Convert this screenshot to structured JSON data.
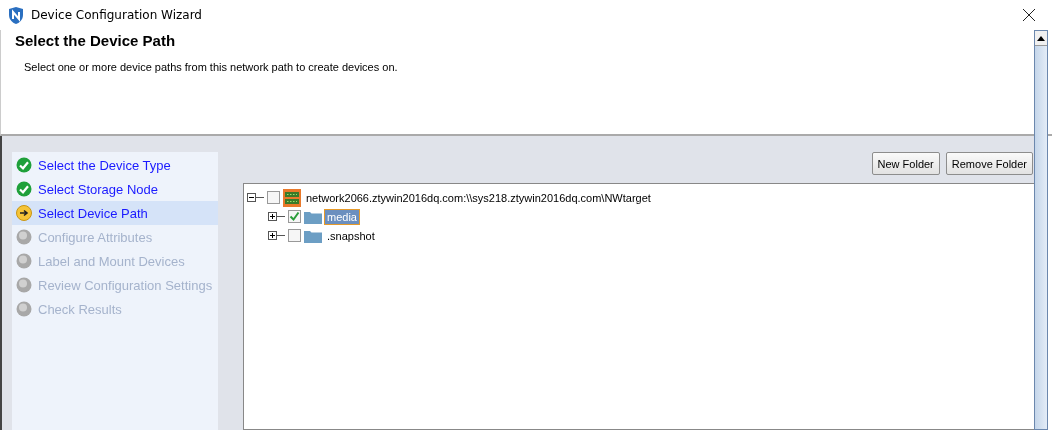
{
  "window": {
    "title": "Device Configuration Wizard"
  },
  "header": {
    "title": "Select the Device Path",
    "description": "Select one or more device paths from this network path to create devices on."
  },
  "steps": [
    {
      "label": "Select the Device Type",
      "kind": "done",
      "selected": false
    },
    {
      "label": "Select Storage Node",
      "kind": "done",
      "selected": false
    },
    {
      "label": "Select Device Path",
      "kind": "current",
      "selected": true
    },
    {
      "label": "Configure Attributes",
      "kind": "pending",
      "selected": false
    },
    {
      "label": "Label and Mount Devices",
      "kind": "pending",
      "selected": false
    },
    {
      "label": "Review Configuration Settings",
      "kind": "pending",
      "selected": false
    },
    {
      "label": "Check Results",
      "kind": "pending",
      "selected": false
    }
  ],
  "buttons": [
    "New Folder",
    "Remove Folder"
  ],
  "tree": [
    {
      "label": "network2066.ztywin2016dq.com:\\\\sys218.ztywin2016dq.com\\NWtarget",
      "kind": "share",
      "expanded": true,
      "checked": false,
      "selected": false,
      "children": [
        {
          "label": "media",
          "kind": "folder",
          "expanded": false,
          "checked": true,
          "selected": true
        },
        {
          "label": ".snapshot",
          "kind": "folder",
          "expanded": false,
          "checked": false,
          "selected": false
        }
      ]
    }
  ]
}
